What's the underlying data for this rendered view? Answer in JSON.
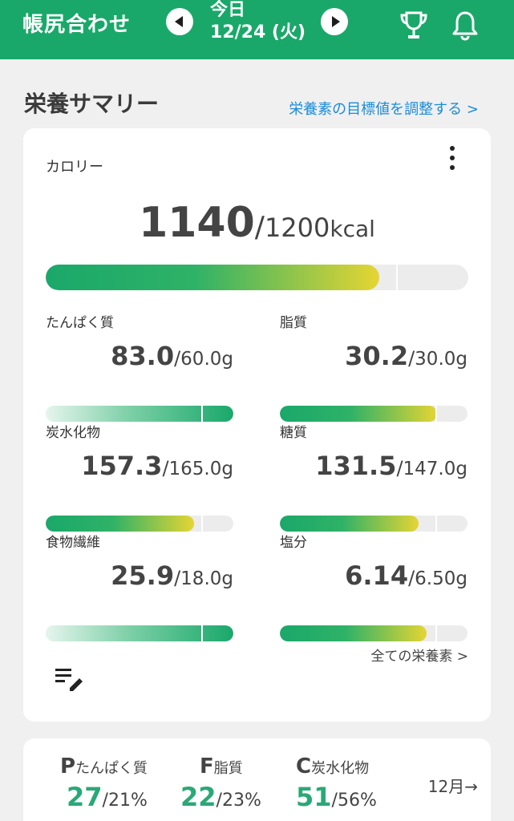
{
  "header": {
    "app_title": "帳尻合わせ",
    "date_label": "今日",
    "date_value": "12/24 (火)",
    "bg_color": "#1aa86a"
  },
  "section": {
    "title": "栄養サマリー",
    "adjust_link": "栄養素の目標値を調整する >"
  },
  "summary_card": {
    "calorie_label": "カロリー",
    "calorie": {
      "value": "1140",
      "slash": "/",
      "goal": "1200",
      "unit": "kcal",
      "fraction": 0.95
    },
    "nutrients": [
      {
        "label": "たんぱく質",
        "value": "83.0",
        "slash": "/",
        "goal": "60.0",
        "unit": "g",
        "ratio": 1.38,
        "over": true
      },
      {
        "label": "脂質",
        "value": "30.2",
        "slash": "/",
        "goal": "30.0",
        "unit": "g",
        "ratio": 1.01,
        "over": false
      },
      {
        "label": "炭水化物",
        "value": "157.3",
        "slash": "/",
        "goal": "165.0",
        "unit": "g",
        "ratio": 0.95,
        "over": false
      },
      {
        "label": "糖質",
        "value": "131.5",
        "slash": "/",
        "goal": "147.0",
        "unit": "g",
        "ratio": 0.89,
        "over": false
      },
      {
        "label": "食物繊維",
        "value": "25.9",
        "slash": "/",
        "goal": "18.0",
        "unit": "g",
        "ratio": 1.44,
        "over": true
      },
      {
        "label": "塩分",
        "value": "6.14",
        "slash": "/",
        "goal": "6.50",
        "unit": "g",
        "ratio": 0.94,
        "over": false
      }
    ],
    "all_nutrients_link": "全ての栄養素 >"
  },
  "pfc_card": {
    "items": [
      {
        "letter": "P",
        "label": "たんぱく質",
        "value": "27",
        "target": "/21%"
      },
      {
        "letter": "F",
        "label": "脂質",
        "value": "22",
        "target": "/23%"
      },
      {
        "letter": "C",
        "label": "炭水化物",
        "value": "51",
        "target": "/56%"
      }
    ],
    "month_link": "12月→"
  },
  "icons": [
    "back-arrow-icon",
    "forward-arrow-icon",
    "trophy-icon",
    "bell-icon",
    "more-vertical-icon",
    "edit-list-icon"
  ]
}
